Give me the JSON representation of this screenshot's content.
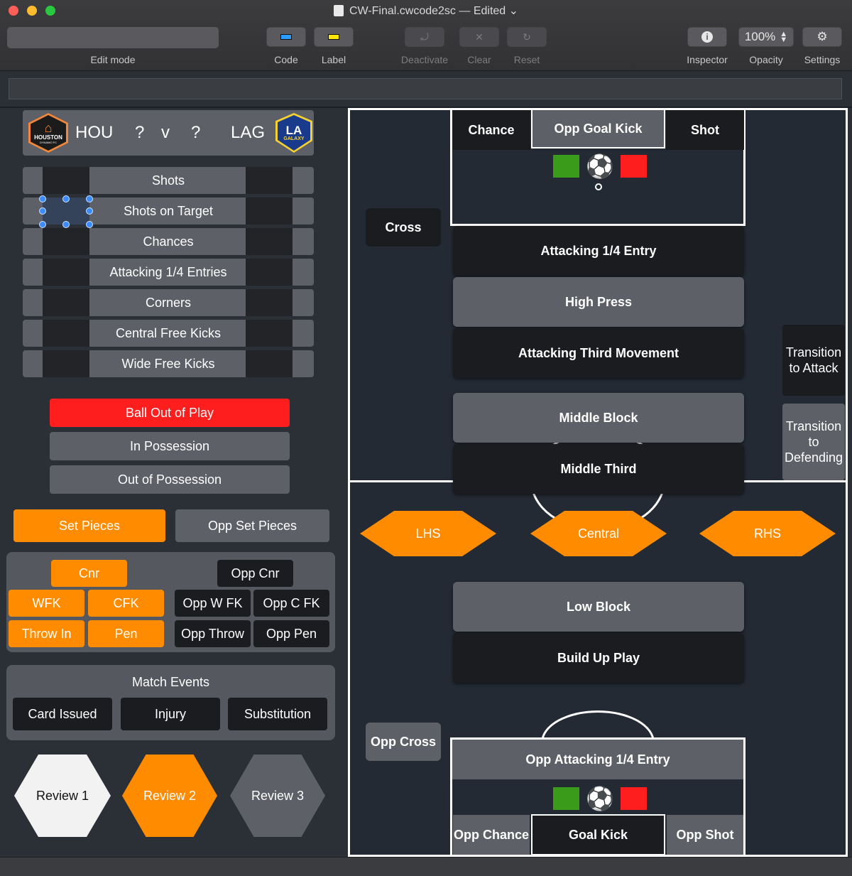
{
  "window": {
    "title": "CW-Final.cwcode2sc — Edited ⌄"
  },
  "toolbar": {
    "edit_mode_label": "Edit mode",
    "code_label": "Code",
    "label_label": "Label",
    "deactivate_label": "Deactivate",
    "clear_label": "Clear",
    "reset_label": "Reset",
    "inspector_label": "Inspector",
    "opacity_label": "Opacity",
    "opacity_value": "100%",
    "settings_label": "Settings"
  },
  "match": {
    "home": "HOU",
    "home_score": "?",
    "vs": "v",
    "away_score": "?",
    "away": "LAG",
    "home_logo_text": "HOUSTON",
    "home_logo_sub": "DYNAMO FC",
    "away_logo_text": "LA",
    "away_logo_sub": "GALAXY"
  },
  "stats": [
    "Shots",
    "Shots on Target",
    "Chances",
    "Attacking 1/4 Entries",
    "Corners",
    "Central Free Kicks",
    "Wide Free Kicks"
  ],
  "possession": {
    "ball_out": "Ball Out of Play",
    "in_poss": "In Possession",
    "out_poss": "Out of Possession"
  },
  "set_pieces": {
    "tab_own": "Set Pieces",
    "tab_opp": "Opp Set Pieces",
    "cnr": "Cnr",
    "wfk": "WFK",
    "cfk": "CFK",
    "throw": "Throw In",
    "pen": "Pen",
    "opp_cnr": "Opp Cnr",
    "opp_wfk": "Opp W FK",
    "opp_cfk": "Opp C FK",
    "opp_throw": "Opp Throw",
    "opp_pen": "Opp Pen"
  },
  "match_events": {
    "title": "Match Events",
    "card": "Card Issued",
    "injury": "Injury",
    "sub": "Substitution"
  },
  "reviews": [
    "Review 1",
    "Review 2",
    "Review 3"
  ],
  "pitch": {
    "chance": "Chance",
    "opp_goal_kick": "Opp Goal Kick",
    "shot": "Shot",
    "cross": "Cross",
    "att_entry": "Attacking 1/4 Entry",
    "high_press": "High Press",
    "att_third": "Attacking Third Movement",
    "trans_attack": "Transition to Attack",
    "middle_block": "Middle Block",
    "trans_defend": "Transition to Defending",
    "middle_third": "Middle Third",
    "lhs": "LHS",
    "central": "Central",
    "rhs": "RHS",
    "low_block": "Low Block",
    "build_up": "Build Up Play",
    "opp_cross": "Opp Cross",
    "opp_att_entry": "Opp Attacking 1/4 Entry",
    "opp_chance": "Opp Chance",
    "goal_kick": "Goal Kick",
    "opp_shot": "Opp Shot"
  },
  "colors": {
    "orange": "#ff8c00",
    "red": "#ff1e1e",
    "green": "#3a9a1a",
    "grey": "#5d6066",
    "black": "#1b1c1f"
  }
}
